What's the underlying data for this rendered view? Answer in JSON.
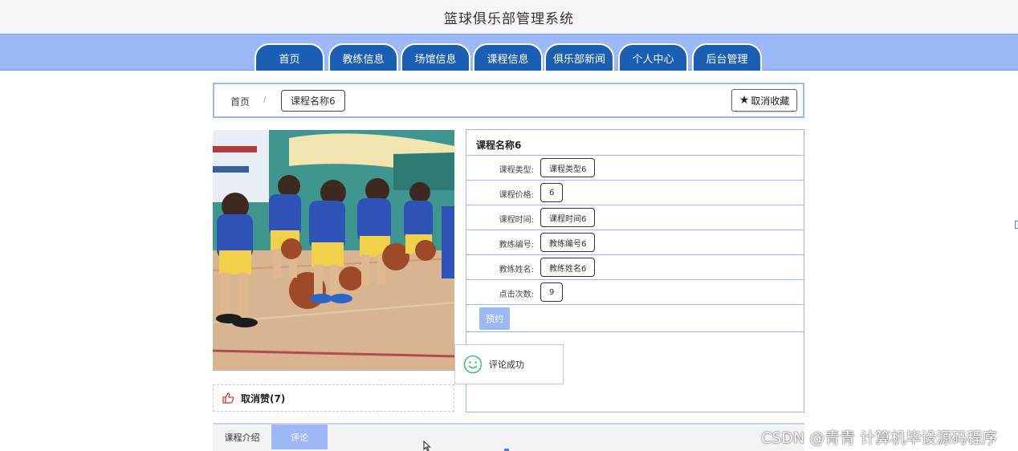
{
  "header": {
    "site_title": "篮球俱乐部管理系统"
  },
  "nav": {
    "items": [
      {
        "label": "首页"
      },
      {
        "label": "教练信息"
      },
      {
        "label": "场馆信息"
      },
      {
        "label": "课程信息"
      },
      {
        "label": "俱乐部新闻"
      },
      {
        "label": "个人中心"
      },
      {
        "label": "后台管理"
      }
    ]
  },
  "breadcrumb": {
    "home": "首页",
    "separator": "/",
    "current": "课程名称6"
  },
  "favorite": {
    "label": "取消收藏",
    "icon": "star-icon"
  },
  "like": {
    "label": "取消赞(7)",
    "icon": "thumbs-up-icon"
  },
  "detail": {
    "title": "课程名称6",
    "rows": [
      {
        "label": "课程类型:",
        "value": "课程类型6"
      },
      {
        "label": "课程价格:",
        "value": "6"
      },
      {
        "label": "课程时间:",
        "value": "课程时间6"
      },
      {
        "label": "教练编号:",
        "value": "教练编号6"
      },
      {
        "label": "教练姓名:",
        "value": "教练姓名6"
      },
      {
        "label": "点击次数:",
        "value": "9"
      }
    ],
    "book_label": "预约"
  },
  "toast": {
    "text": "评论成功",
    "icon": "smile-icon"
  },
  "tabs": {
    "intro": "课程介绍",
    "comments": "评论"
  },
  "watermark": "CSDN @青青  计算机毕设源码程序",
  "colors": {
    "nav_bg": "#9db8f7",
    "tab_blue": "#1a5fb4",
    "accent": "#9db8f7"
  }
}
